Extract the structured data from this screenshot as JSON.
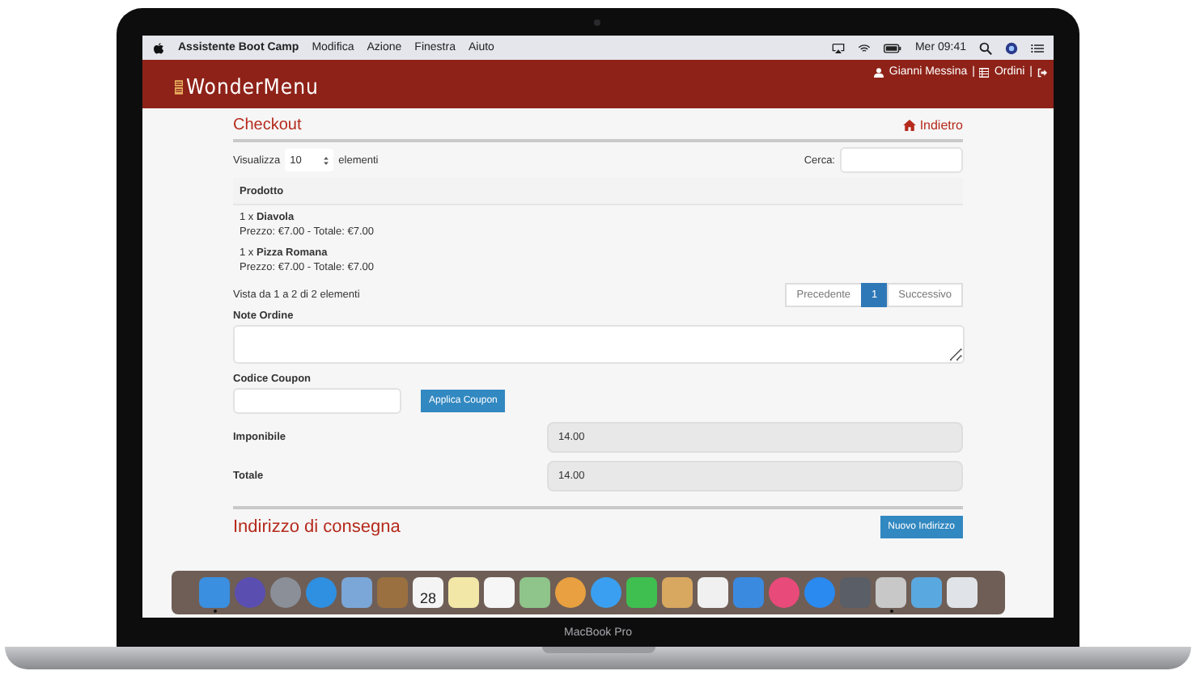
{
  "menubar": {
    "app_name": "Assistente Boot Camp",
    "menus": [
      "Modifica",
      "Azione",
      "Finestra",
      "Aiuto"
    ],
    "clock": "Mer 09:41"
  },
  "header": {
    "brand": "WonderMenu",
    "user": "Gianni Messina",
    "separator_1": "|",
    "orders": "Ordini",
    "separator_2": "|"
  },
  "checkout": {
    "title": "Checkout",
    "back_link": "Indietro",
    "length_label": "Visualizza",
    "length_value": "10",
    "length_suffix": "elementi",
    "search_label": "Cerca:",
    "table": {
      "column": "Prodotto",
      "rows": [
        {
          "text": "1 x **Diavola**",
          "detail": "Prezzo: €7.00 - Totale: €7.00"
        },
        {
          "text": "1 x **Pizza Romana**",
          "detail": "Prezzo: €7.00 - Totale: €7.00"
        }
      ]
    },
    "info": "Vista da 1 a 2 di 2 elementi",
    "pagination": [
      {
        "label": "Precedente",
        "selected": false
      },
      {
        "label": "1",
        "selected": true
      },
      {
        "label": "Successivo",
        "selected": false
      }
    ],
    "notes_label": "Note Ordine",
    "coupon_label": "Codice Coupon",
    "coupon_button": "Applica Coupon",
    "totals": [
      {
        "label": "Imponibile",
        "value": "14.00"
      },
      {
        "label": "Totale",
        "value": "14.00"
      }
    ],
    "address_title": "Indirizzo di consegna",
    "address_button": "Nuovo Indirizzo"
  },
  "dock": {
    "items": [
      {
        "kind": "square",
        "color": "#3a8fe0",
        "running": true
      },
      {
        "kind": "round",
        "color": "#5a4fb0",
        "running": false
      },
      {
        "kind": "round",
        "color": "#8a8f98",
        "running": false
      },
      {
        "kind": "round",
        "color": "#2f8fe0",
        "running": false
      },
      {
        "kind": "square",
        "color": "#7ba7d8",
        "running": false
      },
      {
        "kind": "square",
        "color": "#9a7040",
        "running": false
      },
      {
        "kind": "calendar",
        "color": "#f4f4f4",
        "label": "28",
        "running": false
      },
      {
        "kind": "square",
        "color": "#f3e7a8",
        "running": false
      },
      {
        "kind": "square",
        "color": "#f6f6f6",
        "running": false
      },
      {
        "kind": "square",
        "color": "#8fc48a",
        "running": false
      },
      {
        "kind": "round",
        "color": "#e8a040",
        "running": false
      },
      {
        "kind": "round",
        "color": "#3a9ff0",
        "running": false
      },
      {
        "kind": "square",
        "color": "#3fbf50",
        "running": false
      },
      {
        "kind": "square",
        "color": "#d8a860",
        "running": false
      },
      {
        "kind": "square",
        "color": "#f0f0f0",
        "running": false
      },
      {
        "kind": "square",
        "color": "#3a8ae0",
        "running": false
      },
      {
        "kind": "round",
        "color": "#e84a7a",
        "running": false
      },
      {
        "kind": "round",
        "color": "#2a8af0",
        "running": false
      },
      {
        "kind": "square",
        "color": "#5a5e66",
        "running": false
      },
      {
        "kind": "square",
        "color": "#c8c8c8",
        "running": true
      },
      {
        "kind": "square",
        "color": "#5aa8e0",
        "running": false
      },
      {
        "kind": "square",
        "color": "#e0e4e8",
        "running": false
      }
    ]
  },
  "laptop": {
    "model": "MacBook Pro"
  }
}
